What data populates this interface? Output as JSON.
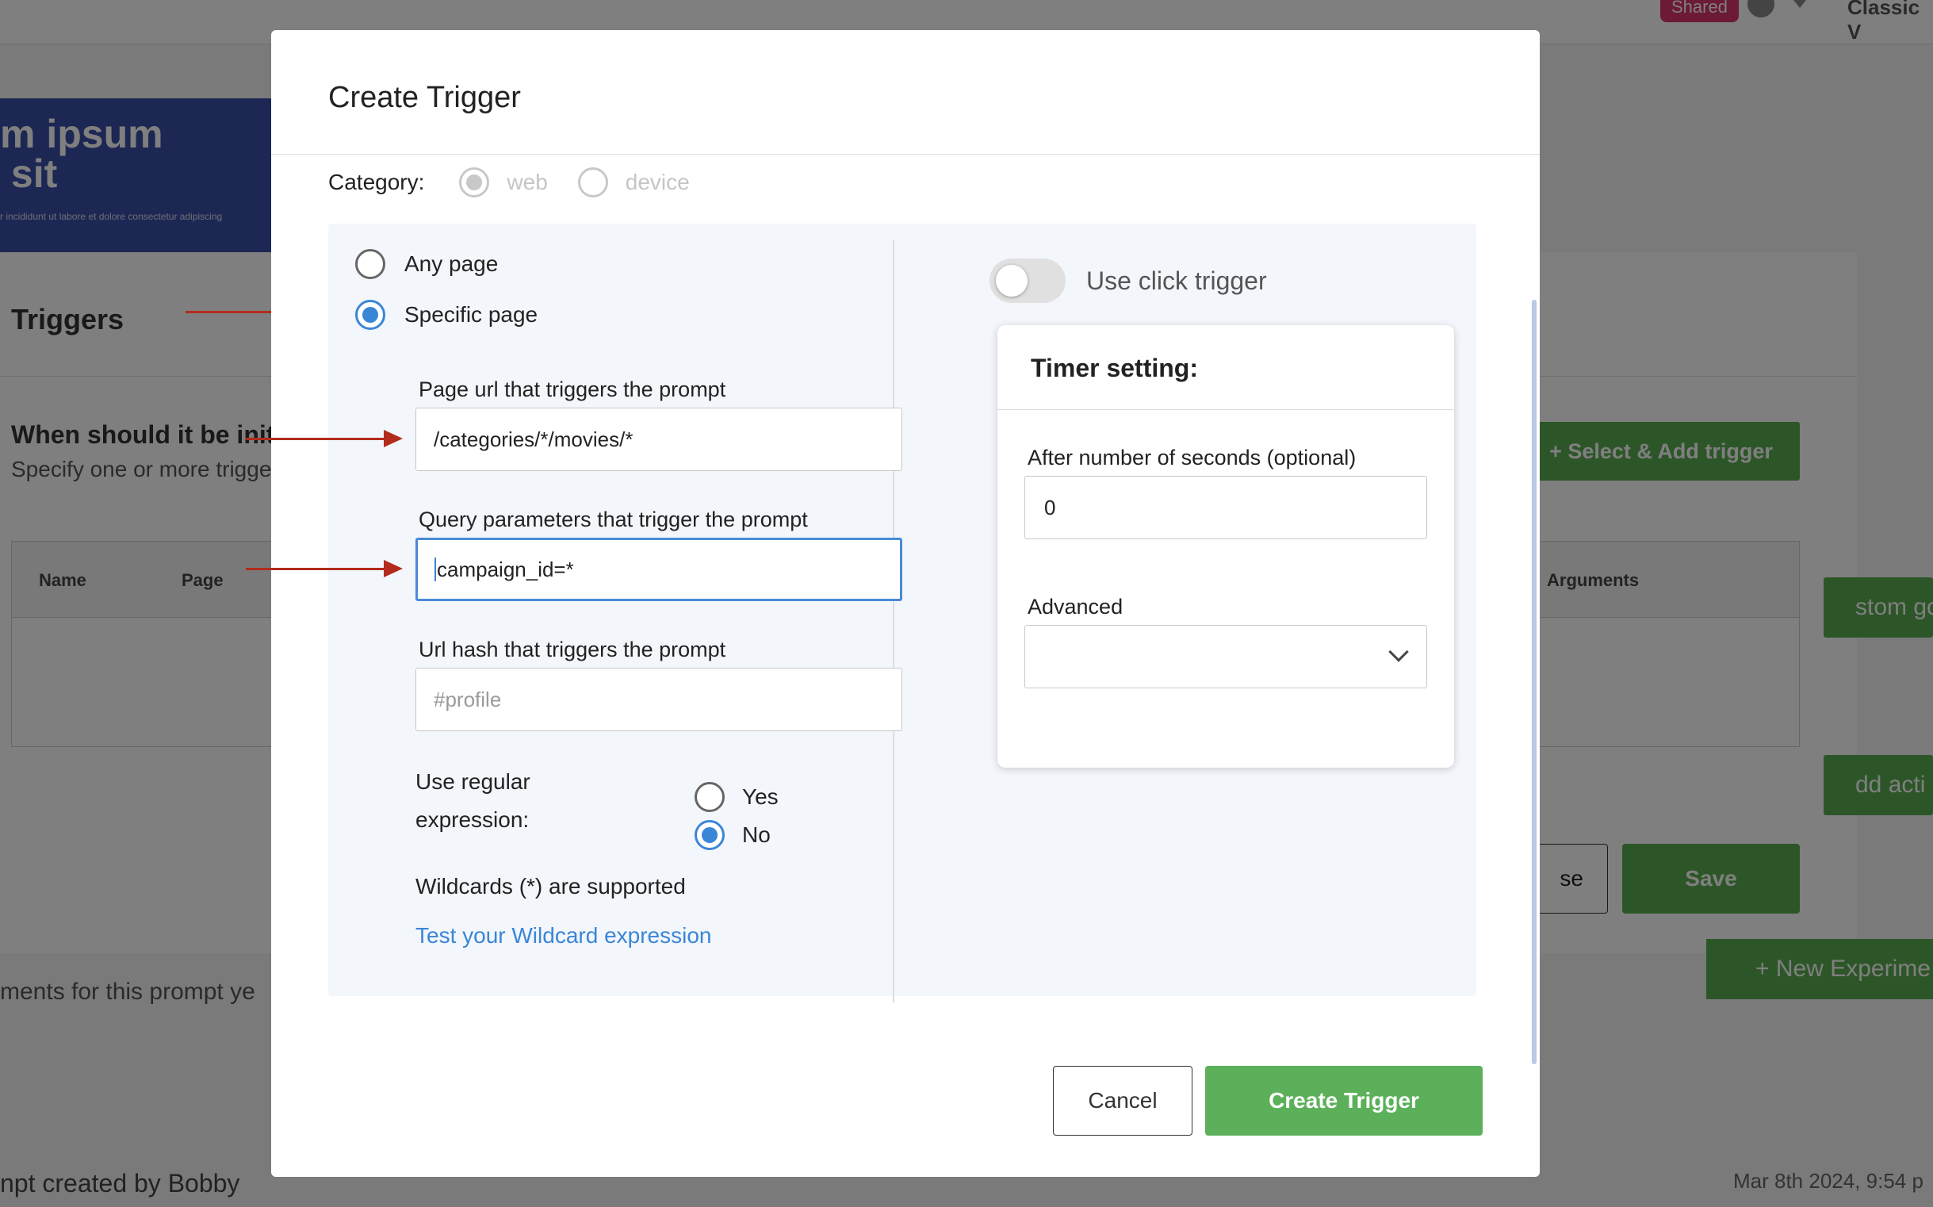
{
  "background": {
    "shared_badge": "Shared",
    "view_label": "Classic V",
    "banner_title": "m ipsum\n sit",
    "banner_small": "r incididunt ut labore et dolore consectetur adipiscing",
    "triggers_title": "Triggers",
    "when_heading": "When should it be init",
    "specify_text": "Specify one or more trigge",
    "table_headers": [
      "Name",
      "Page",
      "Arguments"
    ],
    "select_add_button": "+   Select & Add trigger",
    "custom_button": "stom go",
    "add_action_button": "dd acti",
    "close_button": "se",
    "save_button": "Save",
    "new_experiment_button": "+ New Experime",
    "no_experiments_text": "ments for this prompt ye",
    "footer_left": "npt created by Bobby",
    "footer_right": "Mar 8th 2024, 9:54 p"
  },
  "modal": {
    "title": "Create Trigger",
    "category": {
      "label": "Category:",
      "options": [
        "web",
        "device"
      ],
      "selected": "web"
    },
    "page_options": [
      "Any page",
      "Specific page"
    ],
    "selected_page_option": "Specific page",
    "page_url": {
      "label": "Page url that triggers the prompt",
      "value": "/categories/*/movies/*"
    },
    "query_params": {
      "label": "Query parameters that trigger the prompt",
      "value": "campaign_id=*"
    },
    "url_hash": {
      "label": "Url hash that triggers the prompt",
      "placeholder": "#profile"
    },
    "regex": {
      "label": "Use regular expression:",
      "options": [
        "Yes",
        "No"
      ],
      "selected": "No"
    },
    "wildcards_note": "Wildcards (*) are supported",
    "test_link": "Test your Wildcard expression",
    "click_trigger": {
      "label": "Use click trigger",
      "enabled": false
    },
    "timer": {
      "title": "Timer setting:",
      "seconds_label": "After number of seconds (optional)",
      "seconds_value": "0",
      "advanced_label": "Advanced",
      "advanced_value": ""
    },
    "cancel_button": "Cancel",
    "create_button": "Create Trigger"
  },
  "colors": {
    "accent_blue": "#3a86d6",
    "primary_green": "#5cb05a",
    "annotation_arrow": "#b32b1c"
  }
}
